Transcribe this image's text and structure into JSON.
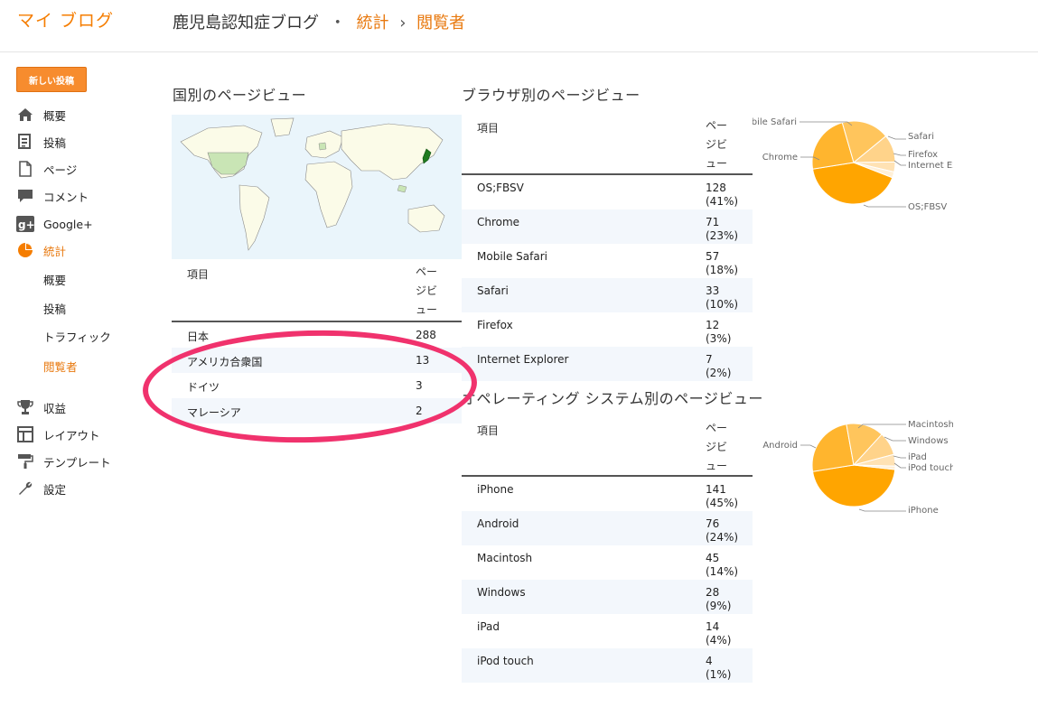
{
  "header": {
    "app_title": "マイ ブログ",
    "blog_name": "鹿児島認知症ブログ",
    "separator_dot": "・",
    "crumb_stats": "統計",
    "crumb_arrow": "›",
    "crumb_viewers": "閲覧者"
  },
  "sidebar": {
    "new_post_label": "新しい投稿",
    "items": [
      {
        "label": "概要",
        "icon": "home-icon"
      },
      {
        "label": "投稿",
        "icon": "posts-icon"
      },
      {
        "label": "ページ",
        "icon": "page-icon"
      },
      {
        "label": "コメント",
        "icon": "comment-icon"
      },
      {
        "label": "Google+",
        "icon": "google-plus-icon"
      },
      {
        "label": "統計",
        "icon": "stats-pie-icon"
      },
      {
        "label": "収益",
        "icon": "trophy-icon"
      },
      {
        "label": "レイアウト",
        "icon": "layout-icon"
      },
      {
        "label": "テンプレート",
        "icon": "paint-roller-icon"
      },
      {
        "label": "設定",
        "icon": "wrench-icon"
      }
    ],
    "sub_items": [
      {
        "label": "概要"
      },
      {
        "label": "投稿"
      },
      {
        "label": "トラフィック"
      },
      {
        "label": "閲覧者"
      }
    ]
  },
  "country": {
    "title": "国別のページビュー",
    "col_item": "項目",
    "col_pv_lines": [
      "ペー",
      "ジビ",
      "ュー"
    ],
    "rows": [
      {
        "name": "日本",
        "value": "288"
      },
      {
        "name": "アメリカ合衆国",
        "value": "13"
      },
      {
        "name": "ドイツ",
        "value": "3"
      },
      {
        "name": "マレーシア",
        "value": "2"
      }
    ]
  },
  "browser": {
    "title": "ブラウザ別のページビュー",
    "col_item": "項目",
    "col_pv_lines": [
      "ペー",
      "ジビ",
      "ュー"
    ],
    "rows": [
      {
        "name": "OS;FBSV",
        "value": "128",
        "pct": "(41%)"
      },
      {
        "name": "Chrome",
        "value": "71",
        "pct": "(23%)"
      },
      {
        "name": "Mobile Safari",
        "value": "57",
        "pct": "(18%)"
      },
      {
        "name": "Safari",
        "value": "33",
        "pct": "(10%)"
      },
      {
        "name": "Firefox",
        "value": "12",
        "pct": "(3%)"
      },
      {
        "name": "Internet Explorer",
        "value": "7",
        "pct": "(2%)"
      }
    ],
    "pie_labels": [
      "Mobile Safari",
      "Safari",
      "Firefox",
      "Internet Ex",
      "Chrome",
      "OS;FBSV"
    ]
  },
  "os": {
    "title": "オペレーティング システム別のページビュー",
    "col_item": "項目",
    "col_pv_lines": [
      "ペー",
      "ジビ",
      "ュー"
    ],
    "rows": [
      {
        "name": "iPhone",
        "value": "141",
        "pct": "(45%)"
      },
      {
        "name": "Android",
        "value": "76",
        "pct": "(24%)"
      },
      {
        "name": "Macintosh",
        "value": "45",
        "pct": "(14%)"
      },
      {
        "name": "Windows",
        "value": "28",
        "pct": "(9%)"
      },
      {
        "name": "iPad",
        "value": "14",
        "pct": "(4%)"
      },
      {
        "name": "iPod touch",
        "value": "4",
        "pct": "(1%)"
      }
    ],
    "pie_labels": [
      "Macintosh",
      "Windows",
      "iPad",
      "iPod touch",
      "Android",
      "iPhone"
    ]
  },
  "chart_data": [
    {
      "type": "pie",
      "categories": [
        "OS;FBSV",
        "Chrome",
        "Mobile Safari",
        "Safari",
        "Firefox",
        "Internet Explorer"
      ],
      "values": [
        128,
        71,
        57,
        33,
        12,
        7
      ],
      "colors": [
        "#ffa500",
        "#ffb52e",
        "#ffc55c",
        "#ffd38a",
        "#ffe2b4",
        "#fff0d8"
      ]
    },
    {
      "type": "pie",
      "categories": [
        "iPhone",
        "Android",
        "Macintosh",
        "Windows",
        "iPad",
        "iPod touch"
      ],
      "values": [
        141,
        76,
        45,
        28,
        14,
        4
      ],
      "colors": [
        "#ffa500",
        "#ffb52e",
        "#ffc55c",
        "#ffd38a",
        "#ffe2b4",
        "#fff0d8"
      ]
    }
  ]
}
